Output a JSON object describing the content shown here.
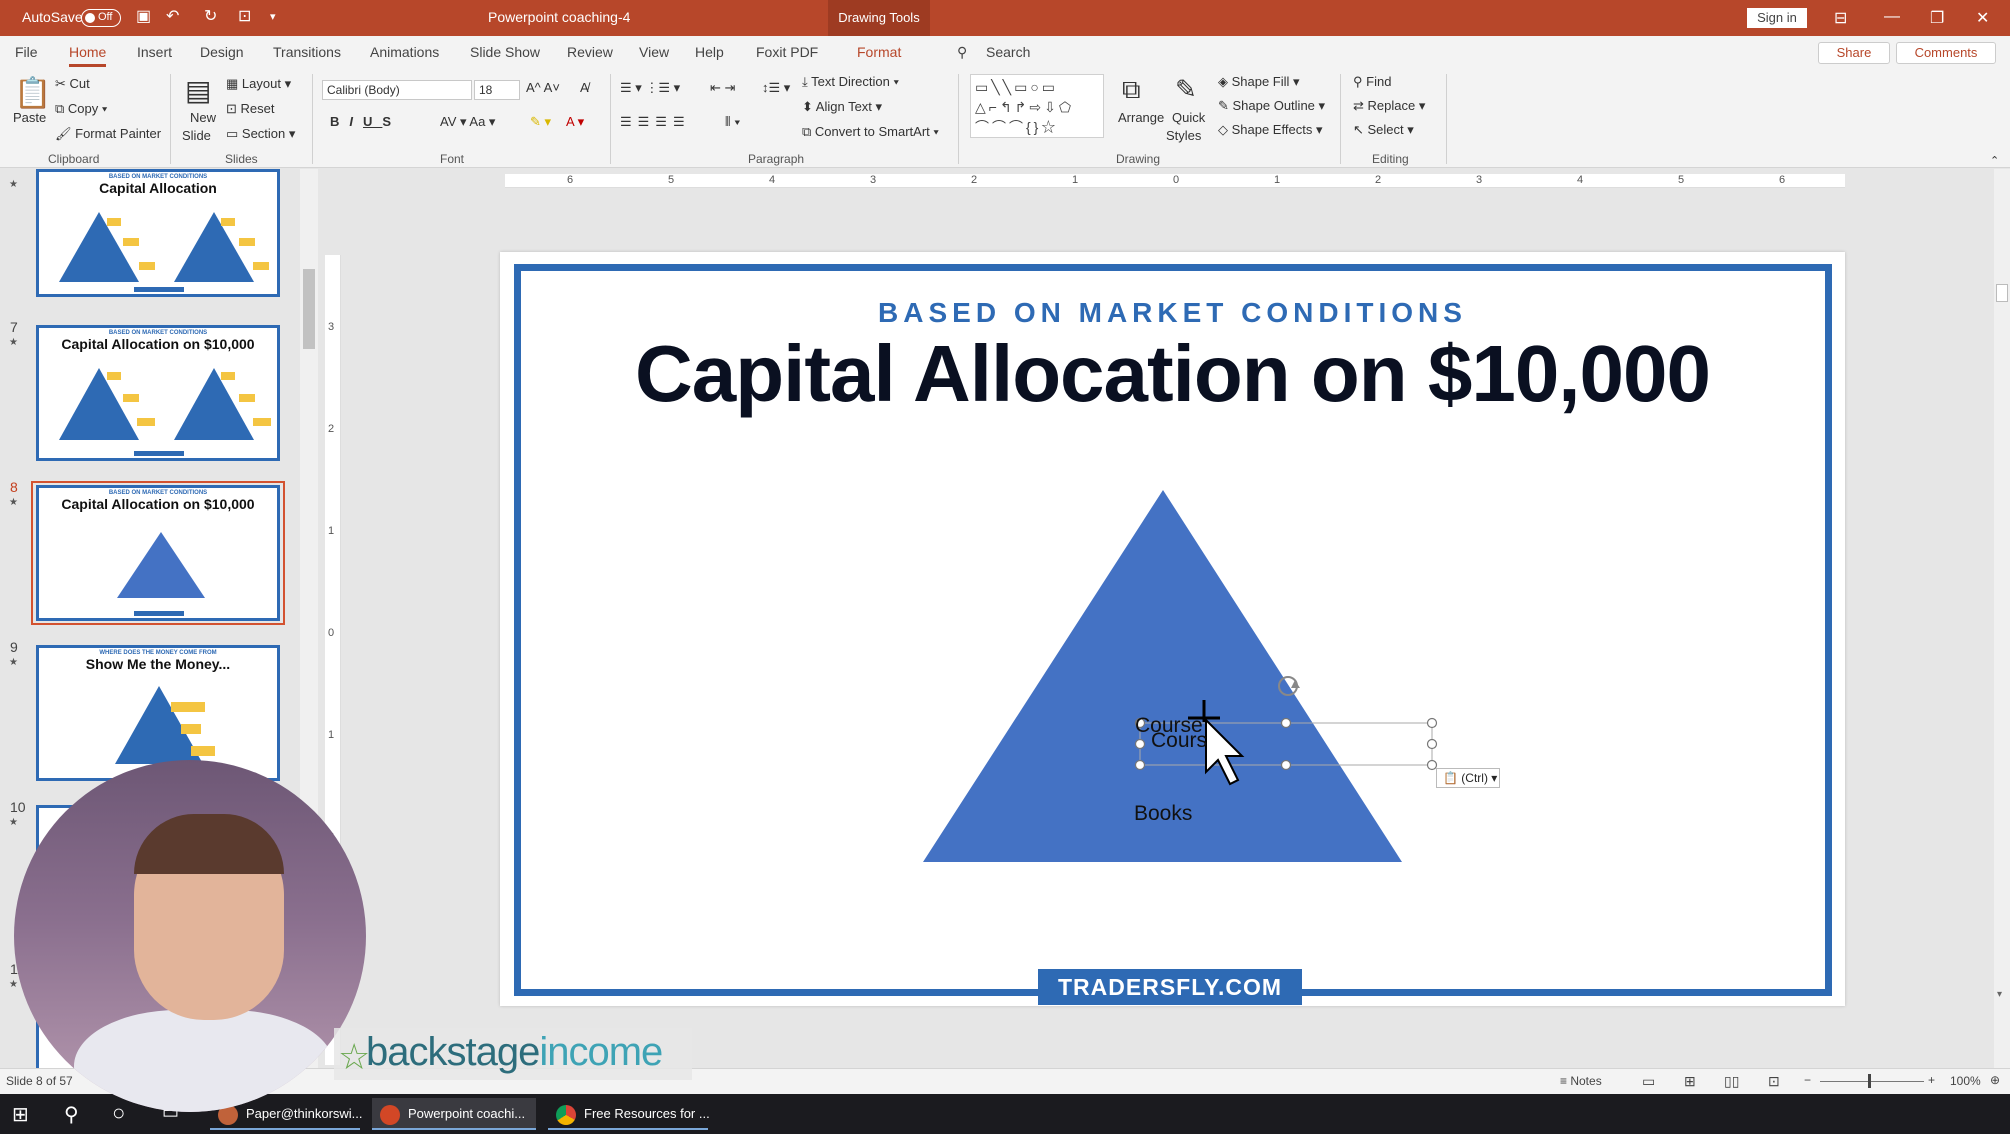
{
  "window": {
    "autosave_label": "AutoSave",
    "autosave_state": "Off",
    "doc_title": "Powerpoint coaching-4",
    "context_tab": "Drawing Tools",
    "sign_in": "Sign in"
  },
  "tabs": [
    "File",
    "Home",
    "Insert",
    "Design",
    "Transitions",
    "Animations",
    "Slide Show",
    "Review",
    "View",
    "Help",
    "Foxit PDF",
    "Format"
  ],
  "active_tab": "Home",
  "search_label": "Search",
  "share_label": "Share",
  "comments_label": "Comments",
  "ribbon": {
    "clipboard": {
      "paste": "Paste",
      "cut": "Cut",
      "copy": "Copy",
      "format_painter": "Format Painter",
      "label": "Clipboard"
    },
    "slides": {
      "new_slide": "New",
      "new_slide2": "Slide",
      "layout": "Layout",
      "reset": "Reset",
      "section": "Section",
      "label": "Slides"
    },
    "font": {
      "family": "Calibri (Body)",
      "size": "18",
      "label": "Font"
    },
    "paragraph": {
      "text_direction": "Text Direction",
      "align_text": "Align Text",
      "convert": "Convert to SmartArt",
      "label": "Paragraph"
    },
    "drawing": {
      "arrange": "Arrange",
      "quick": "Quick",
      "styles": "Styles",
      "shape_fill": "Shape Fill",
      "shape_outline": "Shape Outline",
      "shape_effects": "Shape Effects",
      "label": "Drawing"
    },
    "editing": {
      "find": "Find",
      "replace": "Replace",
      "select": "Select",
      "label": "Editing"
    }
  },
  "thumbnails": [
    {
      "num": "",
      "sub": "BASED ON MARKET CONDITIONS",
      "title": "Capital Allocation"
    },
    {
      "num": "7",
      "sub": "BASED ON MARKET CONDITIONS",
      "title": "Capital Allocation on $10,000"
    },
    {
      "num": "8",
      "sub": "BASED ON MARKET CONDITIONS",
      "title": "Capital Allocation on $10,000"
    },
    {
      "num": "9",
      "sub": "WHERE DOES THE MONEY COME FROM",
      "title": "Show Me the Money..."
    },
    {
      "num": "10",
      "sub": "",
      "title": ""
    },
    {
      "num": "11",
      "sub": "",
      "title": ""
    }
  ],
  "slide": {
    "subtitle": "BASED ON MARKET CONDITIONS",
    "title": "Capital Allocation on $10,000",
    "courses_a": "Course",
    "courses_b": "Cours",
    "books": "Books",
    "footer": "TRADERSFLY.COM",
    "paste_options": "(Ctrl)",
    "pyramid_color": "#4472c4"
  },
  "status": {
    "slide_info": "Slide 8 of 57",
    "notes": "Notes",
    "zoom": "100%"
  },
  "taskbar": [
    {
      "label": "Paper@thinkorswi...",
      "color": "#c0623a"
    },
    {
      "label": "Powerpoint coachi...",
      "color": "#d24726"
    },
    {
      "label": "Free Resources for ...",
      "color": "#4caf50"
    }
  ],
  "overlay_logo": {
    "part1": "backstage",
    "part2": "income"
  },
  "colors": {
    "accent": "#b7472a",
    "slide_blue": "#2e6ab4",
    "title_dark": "#0a1021"
  }
}
